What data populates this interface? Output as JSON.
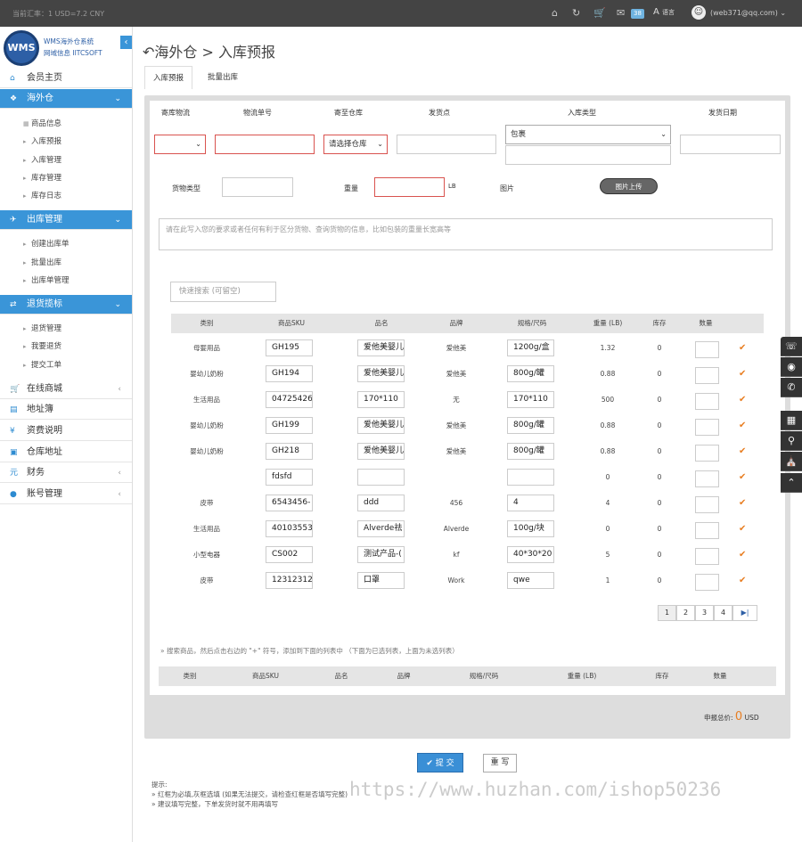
{
  "topbar": {
    "rate": "当前汇率：1 USD=7.2 CNY",
    "msg_count": "38",
    "lang": "语言",
    "user": "(web371@qq.com)"
  },
  "brand": {
    "logo": "WMS",
    "line1": "WMS海外仓系统",
    "line2": "网域信息 IITCSOFT"
  },
  "nav": {
    "home": "会员主页",
    "warehouse": "海外仓",
    "warehouse_items": [
      "商品信息",
      "入库预报",
      "入库管理",
      "库存管理",
      "库存日志"
    ],
    "outbound": "出库管理",
    "outbound_items": [
      "创建出库单",
      "批量出库",
      "出库单管理"
    ],
    "returns": "退货揽标",
    "returns_items": [
      "退货管理",
      "我要退货",
      "提交工单"
    ],
    "shop": "在线商城",
    "address": "地址簿",
    "fees": "资费说明",
    "wh_address": "仓库地址",
    "finance": "财务",
    "account": "账号管理"
  },
  "page": {
    "title": "海外仓 > 入库预报",
    "tab1": "入库预报",
    "tab2": "批量出库"
  },
  "form": {
    "labels": {
      "carrier": "寄库物流",
      "tracking": "物流单号",
      "warehouse": "寄至仓库",
      "origin": "发货点",
      "type": "入库类型",
      "date": "发货日期",
      "goods_type": "货物类型",
      "weight": "重量",
      "unit": "LB",
      "image": "图片"
    },
    "warehouse_select": "请选择仓库",
    "type_select": "包裹",
    "upload": "图片上传",
    "note_placeholder": "请在此写入您的要求或者任何有利于区分货物、查询货物的信息，比如包装的重量长宽高等",
    "search_placeholder": "快速搜索 (可留空)"
  },
  "table": {
    "headers": [
      "类别",
      "商品SKU",
      "品名",
      "品牌",
      "规格/尺码",
      "重量 (LB)",
      "库存",
      "数量"
    ],
    "rows": [
      {
        "cat": "母婴用品",
        "sku": "GH195",
        "name": "爱他美婴儿",
        "brand": "爱他美",
        "spec": "1200g/盒",
        "weight": "1.32",
        "stock": "0"
      },
      {
        "cat": "婴幼儿奶粉",
        "sku": "GH194",
        "name": "爱他美婴儿",
        "brand": "爱他美",
        "spec": "800g/罐",
        "weight": "0.88",
        "stock": "0"
      },
      {
        "cat": "生活用品",
        "sku": "04725426",
        "name": "170*110",
        "brand": "无",
        "spec": "170*110",
        "weight": "500",
        "stock": "0"
      },
      {
        "cat": "婴幼儿奶粉",
        "sku": "GH199",
        "name": "爱他美婴儿",
        "brand": "爱他美",
        "spec": "800g/罐",
        "weight": "0.88",
        "stock": "0"
      },
      {
        "cat": "婴幼儿奶粉",
        "sku": "GH218",
        "name": "爱他美婴儿",
        "brand": "爱他美",
        "spec": "800g/罐",
        "weight": "0.88",
        "stock": "0"
      },
      {
        "cat": "",
        "sku": "fdsfd",
        "name": "",
        "brand": "",
        "spec": "",
        "weight": "0",
        "stock": "0"
      },
      {
        "cat": "皮带",
        "sku": "6543456-",
        "name": "ddd",
        "brand": "456",
        "spec": "4",
        "weight": "4",
        "stock": "0"
      },
      {
        "cat": "生活用品",
        "sku": "40103553",
        "name": "Alverde祛",
        "brand": "Alverde",
        "spec": "100g/块",
        "weight": "0",
        "stock": "0"
      },
      {
        "cat": "小型电器",
        "sku": "CS002",
        "name": "测试产品-(",
        "brand": "kf",
        "spec": "40*30*20",
        "weight": "5",
        "stock": "0"
      },
      {
        "cat": "皮带",
        "sku": "12312312",
        "name": "口罩",
        "brand": "Work",
        "spec": "qwe",
        "weight": "1",
        "stock": "0"
      }
    ],
    "pages": [
      "1",
      "2",
      "3",
      "4"
    ],
    "hint": "» 搜索商品，然后点击右边的 \"+\" 符号，添加到下面的列表中 （下面为已选列表，上面为未选列表）",
    "headers2": [
      "类别",
      "商品SKU",
      "品名",
      "品牌",
      "规格/尺码",
      "重量 (LB)",
      "库存",
      "数量"
    ]
  },
  "total": {
    "label": "申报总价:",
    "value": "0",
    "unit": "USD"
  },
  "actions": {
    "submit": "提 交",
    "reset": "重 写"
  },
  "tips": {
    "title": "提示:",
    "line1": "» 红框为必填,灰框选填 (如果无法提交，请检查红框是否填写完整)",
    "line2": "» 建议填写完整，下单发货时就不用再填写"
  },
  "watermark": "https://www.huzhan.com/ishop50236"
}
